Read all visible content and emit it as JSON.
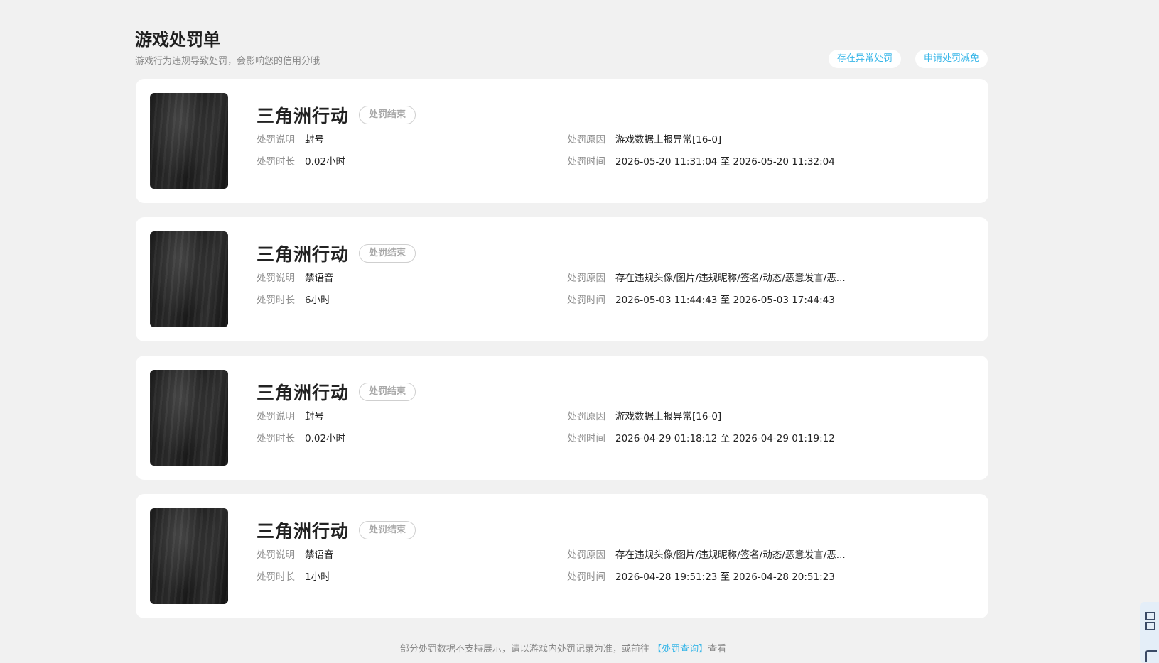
{
  "header": {
    "title": "游戏处罚单",
    "subtitle": "游戏行为违规导致处罚，会影响您的信用分哦",
    "actions": [
      "存在异常处罚",
      "申请处罚减免"
    ]
  },
  "labels": {
    "desc": "处罚说明",
    "duration": "处罚时长",
    "reason": "处罚原因",
    "time": "处罚时间"
  },
  "records": [
    {
      "game": "三角洲行动",
      "status": "处罚结束",
      "desc": "封号",
      "duration": "0.02小时",
      "reason": "游戏数据上报异常[16-0]",
      "time": "2026-05-20 11:31:04 至 2026-05-20 11:32:04"
    },
    {
      "game": "三角洲行动",
      "status": "处罚结束",
      "desc": "禁语音",
      "duration": "6小时",
      "reason": "存在违规头像/图片/违规昵称/签名/动态/恶意发言/恶...",
      "time": "2026-05-03 11:44:43 至 2026-05-03 17:44:43"
    },
    {
      "game": "三角洲行动",
      "status": "处罚结束",
      "desc": "封号",
      "duration": "0.02小时",
      "reason": "游戏数据上报异常[16-0]",
      "time": "2026-04-29 01:18:12 至 2026-04-29 01:19:12"
    },
    {
      "game": "三角洲行动",
      "status": "处罚结束",
      "desc": "禁语音",
      "duration": "1小时",
      "reason": "存在违规头像/图片/违规昵称/签名/动态/恶意发言/恶...",
      "time": "2026-04-28 19:51:23 至 2026-04-28 20:51:23"
    }
  ],
  "footer": {
    "prefix": "部分处罚数据不支持展示，请以游戏内处罚记录为准，或前往",
    "link": "【处罚查询】",
    "suffix": "查看"
  },
  "side_widget": {
    "icons": [
      "qr-code-icon",
      "bracket-icon"
    ]
  }
}
